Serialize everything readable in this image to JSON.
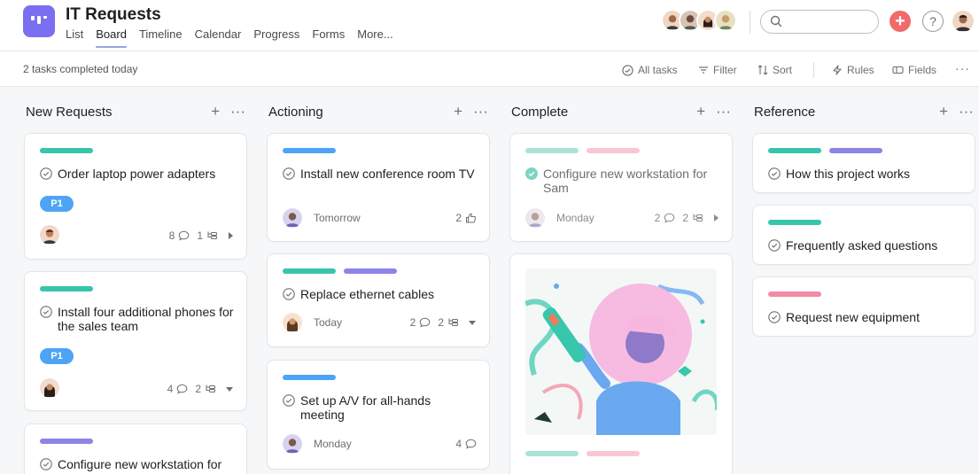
{
  "header": {
    "project_title": "IT Requests",
    "nav": [
      "List",
      "Board",
      "Timeline",
      "Calendar",
      "Progress",
      "Forms",
      "More..."
    ],
    "active_nav": "Board",
    "member_colors": [
      "#d9a273",
      "#8a6e5c",
      "#c07a5a",
      "#e4c27a"
    ],
    "brand_color": "#7a6ff0",
    "add_color": "#f06a6a"
  },
  "toolbar": {
    "completed_text": "2 tasks completed today",
    "all_tasks": "All tasks",
    "filter": "Filter",
    "sort": "Sort",
    "rules": "Rules",
    "fields": "Fields"
  },
  "columns": [
    {
      "title": "New Requests",
      "cards": [
        {
          "title": "Order laptop power adapters",
          "tags": [
            "#37c5ab"
          ],
          "badge": "P1",
          "comments": "8",
          "subtasks": "1"
        },
        {
          "title": "Install four additional phones for the sales team",
          "tags": [
            "#37c5ab"
          ],
          "badge": "P1",
          "comments": "4",
          "subtasks": "2"
        },
        {
          "title": "Configure new workstation for",
          "tags": [
            "#8d84e8"
          ]
        }
      ]
    },
    {
      "title": "Actioning",
      "cards": [
        {
          "title": "Install new conference room TV",
          "tags": [
            "#4ea4f4"
          ],
          "due": "Tomorrow",
          "likes": "2"
        },
        {
          "title": "Replace ethernet cables",
          "tags": [
            "#37c5ab",
            "#8d84e8"
          ],
          "due": "Today",
          "comments": "2",
          "subtasks": "2"
        },
        {
          "title": "Set up A/V for all-hands meeting",
          "tags": [
            "#4ea4f4"
          ],
          "due": "Monday",
          "comments": "4"
        }
      ]
    },
    {
      "title": "Complete",
      "cards": [
        {
          "title": "Configure new workstation for Sam",
          "tags": [
            "#a9e4d6",
            "#f9c7d2"
          ],
          "due": "Monday",
          "comments": "2",
          "subtasks": "2"
        }
      ]
    },
    {
      "title": "Reference",
      "cards": [
        {
          "title": "How this project works",
          "tags": [
            "#37c5ab",
            "#8d84e8"
          ]
        },
        {
          "title": "Frequently asked questions",
          "tags": [
            "#37c5ab"
          ]
        },
        {
          "title": "Request new equipment",
          "tags": [
            "#f28ba3"
          ]
        }
      ]
    }
  ]
}
